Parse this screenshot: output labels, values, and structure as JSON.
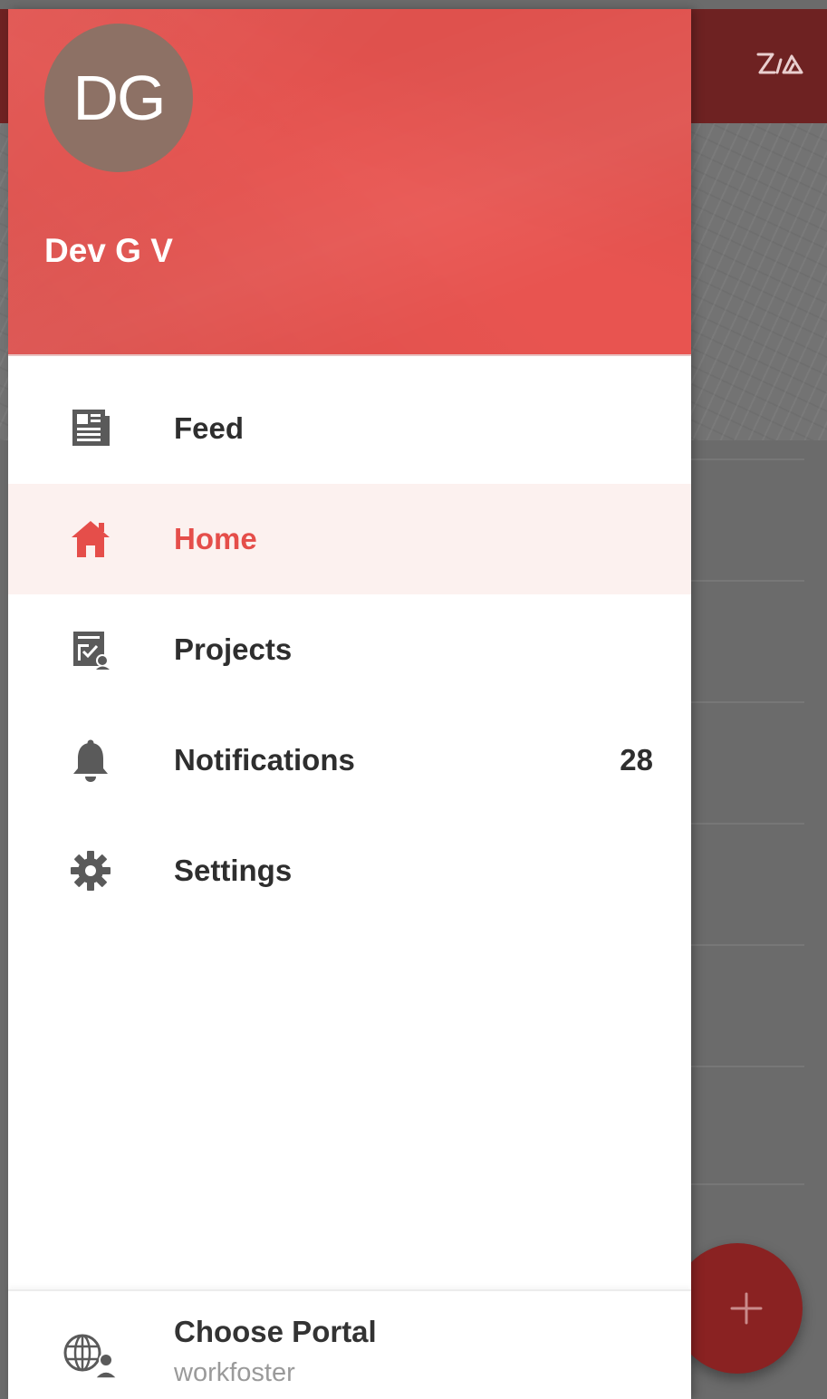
{
  "app": {
    "logo_icon": "zia-logo-icon",
    "fab_icon": "plus-icon"
  },
  "user": {
    "initials": "DG",
    "name": "Dev G V"
  },
  "nav": {
    "items": [
      {
        "id": "feed",
        "label": "Feed",
        "icon": "newspaper-icon",
        "active": false
      },
      {
        "id": "home",
        "label": "Home",
        "icon": "home-icon",
        "active": true
      },
      {
        "id": "projects",
        "label": "Projects",
        "icon": "projects-icon",
        "active": false
      },
      {
        "id": "notifications",
        "label": "Notifications",
        "icon": "bell-icon",
        "active": false,
        "count": "28"
      },
      {
        "id": "settings",
        "label": "Settings",
        "icon": "gear-icon",
        "active": false
      }
    ]
  },
  "portal": {
    "title": "Choose Portal",
    "current": "workfoster",
    "icon": "globe-user-icon"
  },
  "colors": {
    "header": "#e85450",
    "accent": "#e54e4a",
    "active_bg": "#fcf1ef",
    "avatar": "#8d7165",
    "icon": "#5a5a5a"
  }
}
